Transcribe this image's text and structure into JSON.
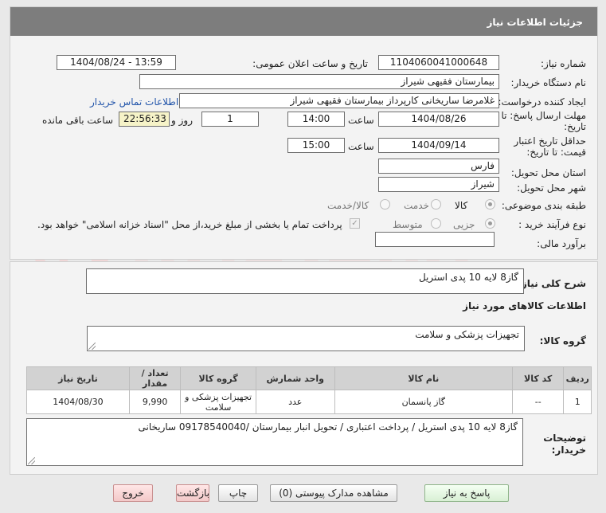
{
  "header": {
    "title": "جزئیات اطلاعات نیاز"
  },
  "fields": {
    "need_number_label": "شماره نیاز:",
    "need_number": "1104060041000648",
    "announce_label": "تاریخ و ساعت اعلان عمومی:",
    "announce_value": "1404/08/24 - 13:59",
    "buyer_org_label": "نام دستگاه خریدار:",
    "buyer_org": "بیمارستان فقیهی شیراز",
    "requester_label": "ایجاد کننده درخواست:",
    "requester": "غلامرضا ساریخانی کارپرداز بیمارستان فقیهی شیراز",
    "contact_link": "اطلاعات تماس خریدار",
    "deadline_label_1": "مهلت ارسال پاسخ: تا",
    "deadline_label_2": "تاریخ:",
    "deadline_date": "1404/08/26",
    "time_word": "ساعت",
    "deadline_time": "14:00",
    "days_value": "1",
    "days_and": "روز و",
    "remaining_time": "22:56:33",
    "remaining_label": "ساعت باقی مانده",
    "validity_label_1": "حداقل تاریخ اعتبار",
    "validity_label_2": "قیمت: تا تاریخ:",
    "validity_date": "1404/09/14",
    "validity_time": "15:00",
    "province_label": "استان محل تحویل:",
    "province": "فارس",
    "city_label": "شهر محل تحویل:",
    "city": "شیراز",
    "category_label": "طبقه بندی موضوعی:",
    "category_options": [
      "کالا",
      "خدمت",
      "کالا/خدمت"
    ],
    "process_label": "نوع فرآیند خرید :",
    "process_options": [
      "جزیی",
      "متوسط"
    ],
    "payment_note": "پرداخت تمام یا بخشی از مبلغ خرید،از محل \"اسناد خزانه اسلامی\" خواهد بود.",
    "estimate_label": "برآورد مالی:",
    "estimate_value": ""
  },
  "details": {
    "summary_label": "شرح کلی نیاز:",
    "summary": "گاز8 لایه 10 پدی استریل",
    "goods_info_title": "اطلاعات کالاهای مورد نیاز",
    "goods_group_label": "گروه کالا:",
    "goods_group": "تجهیزات پزشکی و سلامت",
    "table": {
      "headers": [
        "ردیف",
        "کد کالا",
        "نام کالا",
        "واحد شمارش",
        "گروه کالا",
        "تعداد / مقدار",
        "تاریخ نیاز"
      ],
      "rows": [
        [
          "1",
          "--",
          "گاز پانسمان",
          "عدد",
          "تجهیزات پزشکی و سلامت",
          "9,990",
          "1404/08/30"
        ]
      ]
    },
    "buyer_notes_label_1": "توضیحات",
    "buyer_notes_label_2": "خریدار:",
    "buyer_notes": "گاز8 لایه 10 پدی استریل / پرداخت اعتباری / تحویل انبار بیمارستان /09178540040 ساریخانی"
  },
  "buttons": {
    "reply": "پاسخ به نیاز",
    "attachments": "مشاهده مدارک پیوستی (0)",
    "print": "چاپ",
    "back": "بازگشت",
    "exit": "خروج"
  },
  "colors": {
    "header_bg": "#7d7d7d",
    "highlight_box": "#f6f3c8",
    "link": "#2255aa"
  }
}
